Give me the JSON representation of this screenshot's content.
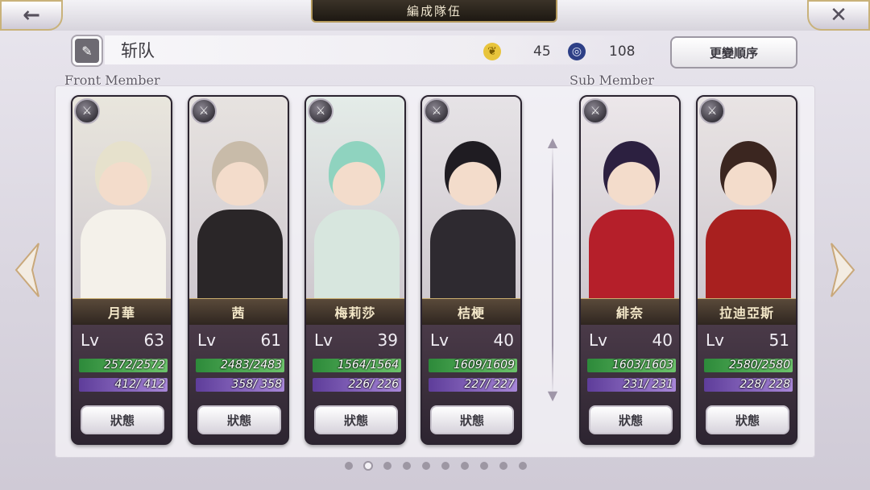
{
  "header": {
    "title": "編成隊伍",
    "back_icon": "←",
    "close_icon": "✕"
  },
  "team": {
    "name": "斩队",
    "feather_value": "45",
    "swirl_value": "108",
    "order_button": "更變順序"
  },
  "sections": {
    "front_label": "Front Member",
    "sub_label": "Sub Member"
  },
  "cards": [
    {
      "name": "月華",
      "lv_label": "Lv",
      "lv": "63",
      "hp": "2572/2572",
      "mp": "412/ 412",
      "status": "狀態",
      "colors": {
        "bg": "#e9e6dd",
        "hair": "#e6e1cc",
        "body": "#f4f1ea",
        "accent": "#cf2a2a"
      }
    },
    {
      "name": "茜",
      "lv_label": "Lv",
      "lv": "61",
      "hp": "2483/2483",
      "mp": "358/ 358",
      "status": "狀態",
      "colors": {
        "bg": "#e7e3e0",
        "hair": "#c8bba9",
        "body": "#2a2628",
        "accent": "#c9a55a"
      }
    },
    {
      "name": "梅莉莎",
      "lv_label": "Lv",
      "lv": "39",
      "hp": "1564/1564",
      "mp": "226/ 226",
      "status": "狀態",
      "colors": {
        "bg": "#e4ece8",
        "hair": "#8fd3bf",
        "body": "#d7e6de",
        "accent": "#2c2c2c"
      }
    },
    {
      "name": "桔梗",
      "lv_label": "Lv",
      "lv": "40",
      "hp": "1609/1609",
      "mp": "227/ 227",
      "status": "狀態",
      "colors": {
        "bg": "#e6e3e6",
        "hair": "#1f1c22",
        "body": "#2e2a30",
        "accent": "#d4a84a"
      }
    },
    {
      "name": "緋奈",
      "lv_label": "Lv",
      "lv": "40",
      "hp": "1603/1603",
      "mp": "231/ 231",
      "status": "狀態",
      "colors": {
        "bg": "#ece7ea",
        "hair": "#2c2040",
        "body": "#b51f2a",
        "accent": "#ffffff"
      }
    },
    {
      "name": "拉迪亞斯",
      "lv_label": "Lv",
      "lv": "51",
      "hp": "2580/2580",
      "mp": "228/ 228",
      "status": "狀態",
      "colors": {
        "bg": "#e9e4e4",
        "hair": "#3b2620",
        "body": "#a8201f",
        "accent": "#d6b24c"
      }
    }
  ],
  "pagination": {
    "total": 10,
    "active_index": 1
  }
}
